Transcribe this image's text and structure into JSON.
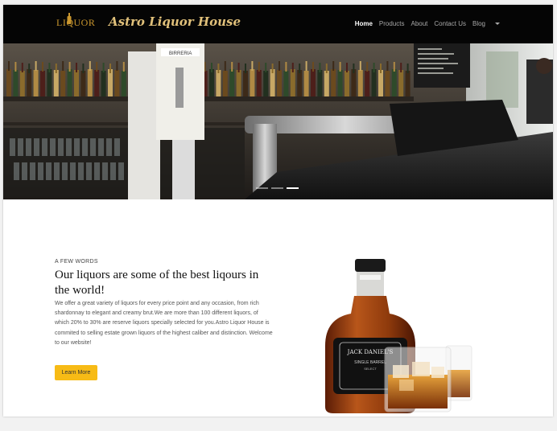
{
  "navbar": {
    "logo_text": "LIQUOR",
    "brand": "Astro Liquor House",
    "links": [
      {
        "label": "Home",
        "active": true
      },
      {
        "label": "Products",
        "active": false
      },
      {
        "label": "About",
        "active": false
      },
      {
        "label": "Contact Us",
        "active": false
      },
      {
        "label": "Blog",
        "active": false
      }
    ]
  },
  "hero": {
    "sign_text": "BIRRERIA",
    "slide_count": 3,
    "active_slide": 1
  },
  "intro": {
    "eyebrow": "A FEW WORDS",
    "heading": "Our liquors are some of the best liqours in the world!",
    "body": "We offer a great variety of liquors for every price point and any occasion, from rich shardonnay to elegant and creamy brut.We are more than 100 different liquors, of which 20% to 30% are reserve liquors specially selected for you.Astro Liquor House is commited to selling estate grown liquors of the highest caliber and distinction. Welcome to our website!",
    "button_label": "Learn More"
  },
  "product": {
    "label_line1": "JACK DANIEL'S",
    "label_line2": "SINGLE BARREL",
    "label_line3": "SELECT"
  },
  "colors": {
    "navbar_bg": "#050505",
    "brand_gold": "#e0c07a",
    "button": "#f7bb16"
  }
}
